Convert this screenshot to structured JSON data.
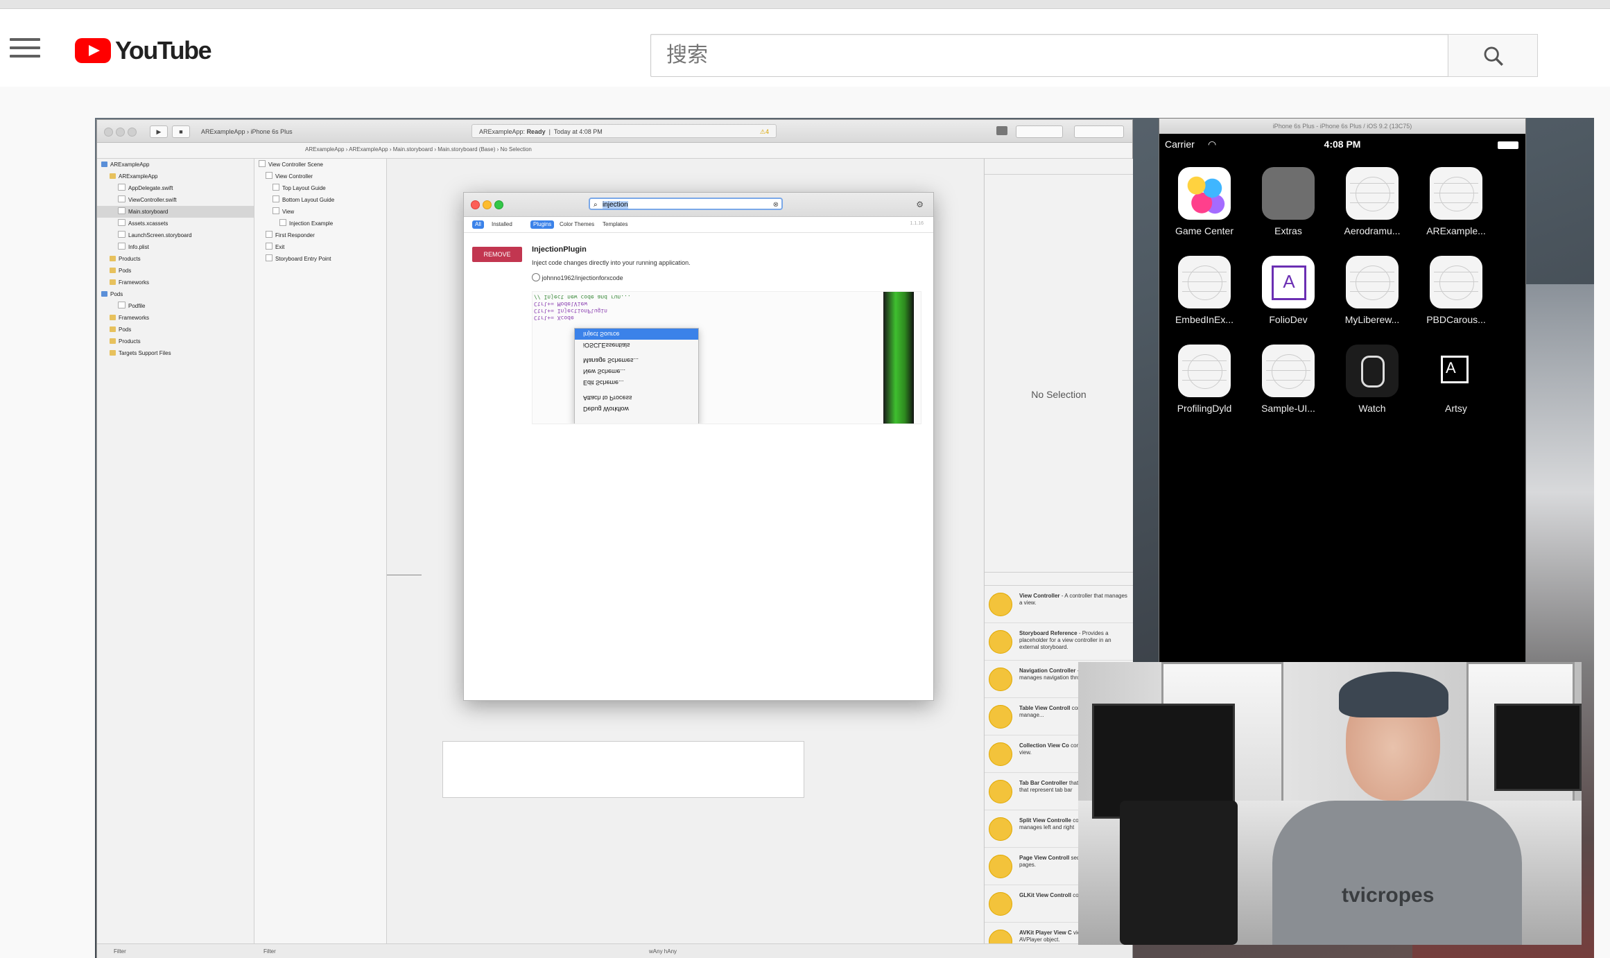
{
  "masthead": {
    "logo_text": "YouTube",
    "search_placeholder": "搜索"
  },
  "xcode": {
    "scheme": "ARExampleApp",
    "device": "iPhone 6s Plus",
    "status_app": "ARExampleApp:",
    "status_state": "Ready",
    "status_time": "Today at 4:08 PM",
    "warnings": "4",
    "breadcrumbs": [
      "ARExampleApp",
      "ARExampleApp",
      "Main.storyboard",
      "Main.storyboard (Base)",
      "No Selection"
    ],
    "navigator": [
      {
        "label": "ARExampleApp",
        "indent": 0,
        "kind": "project"
      },
      {
        "label": "ARExampleApp",
        "indent": 1,
        "kind": "folder"
      },
      {
        "label": "AppDelegate.swift",
        "indent": 2,
        "kind": "file"
      },
      {
        "label": "ViewController.swift",
        "indent": 2,
        "kind": "file"
      },
      {
        "label": "Main.storyboard",
        "indent": 2,
        "kind": "file",
        "selected": true
      },
      {
        "label": "Assets.xcassets",
        "indent": 2,
        "kind": "file"
      },
      {
        "label": "LaunchScreen.storyboard",
        "indent": 2,
        "kind": "file"
      },
      {
        "label": "Info.plist",
        "indent": 2,
        "kind": "file"
      },
      {
        "label": "Products",
        "indent": 1,
        "kind": "folder"
      },
      {
        "label": "Pods",
        "indent": 1,
        "kind": "folder"
      },
      {
        "label": "Frameworks",
        "indent": 1,
        "kind": "folder"
      },
      {
        "label": "Pods",
        "indent": 0,
        "kind": "project"
      },
      {
        "label": "Podfile",
        "indent": 2,
        "kind": "file"
      },
      {
        "label": "Frameworks",
        "indent": 1,
        "kind": "folder"
      },
      {
        "label": "Pods",
        "indent": 1,
        "kind": "folder"
      },
      {
        "label": "Products",
        "indent": 1,
        "kind": "folder"
      },
      {
        "label": "Targets Support Files",
        "indent": 1,
        "kind": "folder"
      }
    ],
    "outline": [
      {
        "label": "View Controller Scene",
        "indent": 0
      },
      {
        "label": "View Controller",
        "indent": 1
      },
      {
        "label": "Top Layout Guide",
        "indent": 2
      },
      {
        "label": "Bottom Layout Guide",
        "indent": 2
      },
      {
        "label": "View",
        "indent": 2
      },
      {
        "label": "Injection Example",
        "indent": 3
      },
      {
        "label": "First Responder",
        "indent": 1
      },
      {
        "label": "Exit",
        "indent": 1
      },
      {
        "label": "Storyboard Entry Point",
        "indent": 1
      }
    ],
    "no_selection": "No Selection",
    "library": [
      {
        "title": "View Controller",
        "desc": "- A controller that manages a view."
      },
      {
        "title": "Storyboard Reference",
        "desc": "- Provides a placeholder for a view controller in an external storyboard."
      },
      {
        "title": "Navigation Controller",
        "desc": "- A controller that manages navigation through a hierarchy of..."
      },
      {
        "title": "Table View Controll",
        "desc": "controller that manage..."
      },
      {
        "title": "Collection View Co",
        "desc": "controller that manage view."
      },
      {
        "title": "Tab Bar Controller",
        "desc": "that manages a set of that represent tab bar"
      },
      {
        "title": "Split View Controlle",
        "desc": "composite view contro manages left and right"
      },
      {
        "title": "Page View Controll",
        "desc": "sequence of view con pages."
      },
      {
        "title": "GLKit View Controll",
        "desc": "controller that manage"
      },
      {
        "title": "AVKit Player View C",
        "desc": "view controller that m AVPlayer object."
      }
    ],
    "filter_placeholder": "Filter",
    "size_class": "wAny hAny"
  },
  "plugin_dialog": {
    "search_value": "injection",
    "tabs": [
      "All",
      "Installed",
      "Plugins",
      "Color Themes",
      "Templates"
    ],
    "version": "1.1.16",
    "remove_label": "REMOVE",
    "plugin_name": "InjectionPlugin",
    "plugin_desc": "Inject code changes directly into your running application.",
    "plugin_link": "johnno1962/injectionforxcode",
    "code_lines": [
      "Ctrl+= Xcode",
      "Ctrl+= InjectionPlugin",
      "Ctrl+= ModelView",
      "// Inject new code and run..."
    ],
    "context_menu": [
      "Inject Source",
      "iOSCLEssentials",
      "Manage Schemes...",
      "New Scheme...",
      "Edit Scheme...",
      "Attach to Process",
      "Debug Workflow"
    ],
    "inject_shortcut": "⌘="
  },
  "simulator": {
    "title": "iPhone 6s Plus - iPhone 6s Plus / iOS 9.2 (13C75)",
    "carrier": "Carrier",
    "time": "4:08 PM",
    "apps": [
      {
        "label": "Game Center",
        "icon": "game-center-icon"
      },
      {
        "label": "Extras",
        "icon": "folder-icon"
      },
      {
        "label": "Aerodramu...",
        "icon": "blank-app-icon"
      },
      {
        "label": "ARExample...",
        "icon": "blank-app-icon"
      },
      {
        "label": "EmbedInEx...",
        "icon": "blank-app-icon"
      },
      {
        "label": "FolioDev",
        "icon": "foliodev-icon"
      },
      {
        "label": "MyLiberew...",
        "icon": "blank-app-icon"
      },
      {
        "label": "PBDCarous...",
        "icon": "blank-app-icon"
      },
      {
        "label": "ProfilingDyld",
        "icon": "blank-app-icon"
      },
      {
        "label": "Sample-UI...",
        "icon": "blank-app-icon"
      },
      {
        "label": "Watch",
        "icon": "watch-icon"
      },
      {
        "label": "Artsy",
        "icon": "artsy-icon"
      }
    ]
  },
  "webcam": {
    "shirt_text": "tvicropes"
  }
}
